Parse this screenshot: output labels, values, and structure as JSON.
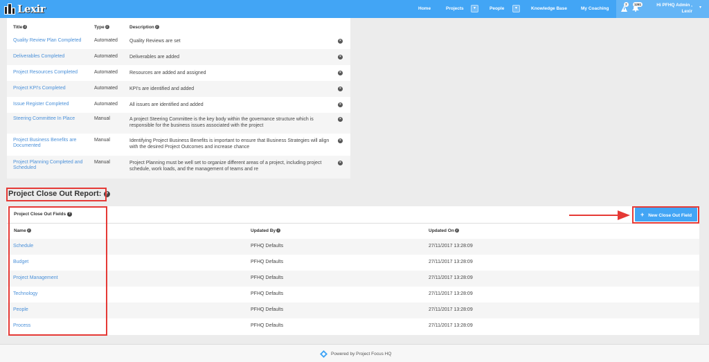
{
  "nav": {
    "logo_text": "Lexir",
    "items": [
      {
        "label": "Home"
      },
      {
        "label": "Projects"
      },
      {
        "label": "People"
      },
      {
        "label": "Knowledge Base"
      },
      {
        "label": "My Coaching"
      }
    ],
    "badges": {
      "tasks": "7",
      "notifications": "1281"
    },
    "user_line1": "Hi PFHQ Admin ,",
    "user_line2": "Lexir",
    "caret": "▾"
  },
  "top_table": {
    "headers": {
      "title": "Title",
      "type": "Type",
      "description": "Description"
    },
    "rows": [
      {
        "title": "Quality Review Plan Completed",
        "type": "Automated",
        "description": "Quality Reviews are set"
      },
      {
        "title": "Deliverables Completed",
        "type": "Automated",
        "description": "Deliverables are added"
      },
      {
        "title": "Project Resources Completed",
        "type": "Automated",
        "description": "Resources are added and assigned"
      },
      {
        "title": "Project KPI's Completed",
        "type": "Automated",
        "description": "KPI's are identified and added"
      },
      {
        "title": "Issue Register Completed",
        "type": "Automated",
        "description": "All issues are identified and added"
      },
      {
        "title": "Steering Committee In Place",
        "type": "Manual",
        "description": "A project Steering Committee is the key body within the governance structure which is responsible for the business issues associated with the project"
      },
      {
        "title": "Project Business Benefits are Documented",
        "type": "Manual",
        "description": "Identifying Project Business Benefits is important to ensure that Business Strategies will align with the desired Project Outcomes and increase chance"
      },
      {
        "title": "Project Planning Completed and Scheduled",
        "type": "Manual",
        "description": "Project Planning must be well set to organize different areas of a project, including project schedule, work loads, and the management of teams and re"
      }
    ],
    "remove_glyph": "×"
  },
  "section": {
    "heading": "Project Close Out Report:",
    "help_glyph": "?"
  },
  "close_out": {
    "panel_title": "Project Close Out Fields",
    "new_button": "New Close Out Field",
    "plus_glyph": "+",
    "headers": {
      "name": "Name",
      "updated_by": "Updated By",
      "updated_on": "Updated On"
    },
    "rows": [
      {
        "name": "Schedule",
        "updated_by": "PFHQ Defaults",
        "updated_on": "27/11/2017 13:28:09"
      },
      {
        "name": "Budget",
        "updated_by": "PFHQ Defaults",
        "updated_on": "27/11/2017 13:28:09"
      },
      {
        "name": "Project Management",
        "updated_by": "PFHQ Defaults",
        "updated_on": "27/11/2017 13:28:09"
      },
      {
        "name": "Technology",
        "updated_by": "PFHQ Defaults",
        "updated_on": "27/11/2017 13:28:09"
      },
      {
        "name": "People",
        "updated_by": "PFHQ Defaults",
        "updated_on": "27/11/2017 13:28:09"
      },
      {
        "name": "Process",
        "updated_by": "PFHQ Defaults",
        "updated_on": "27/11/2017 13:28:09"
      }
    ]
  },
  "footer": {
    "text": "Powered by Project Focus HQ"
  },
  "colors": {
    "navbar": "#42a5f5",
    "link": "#4a90d9",
    "annotation": "#e53935"
  },
  "icons": {
    "info": "info-circle-icon",
    "help": "question-circle-icon",
    "remove": "times-circle-icon",
    "alerts": "warning-icon"
  }
}
